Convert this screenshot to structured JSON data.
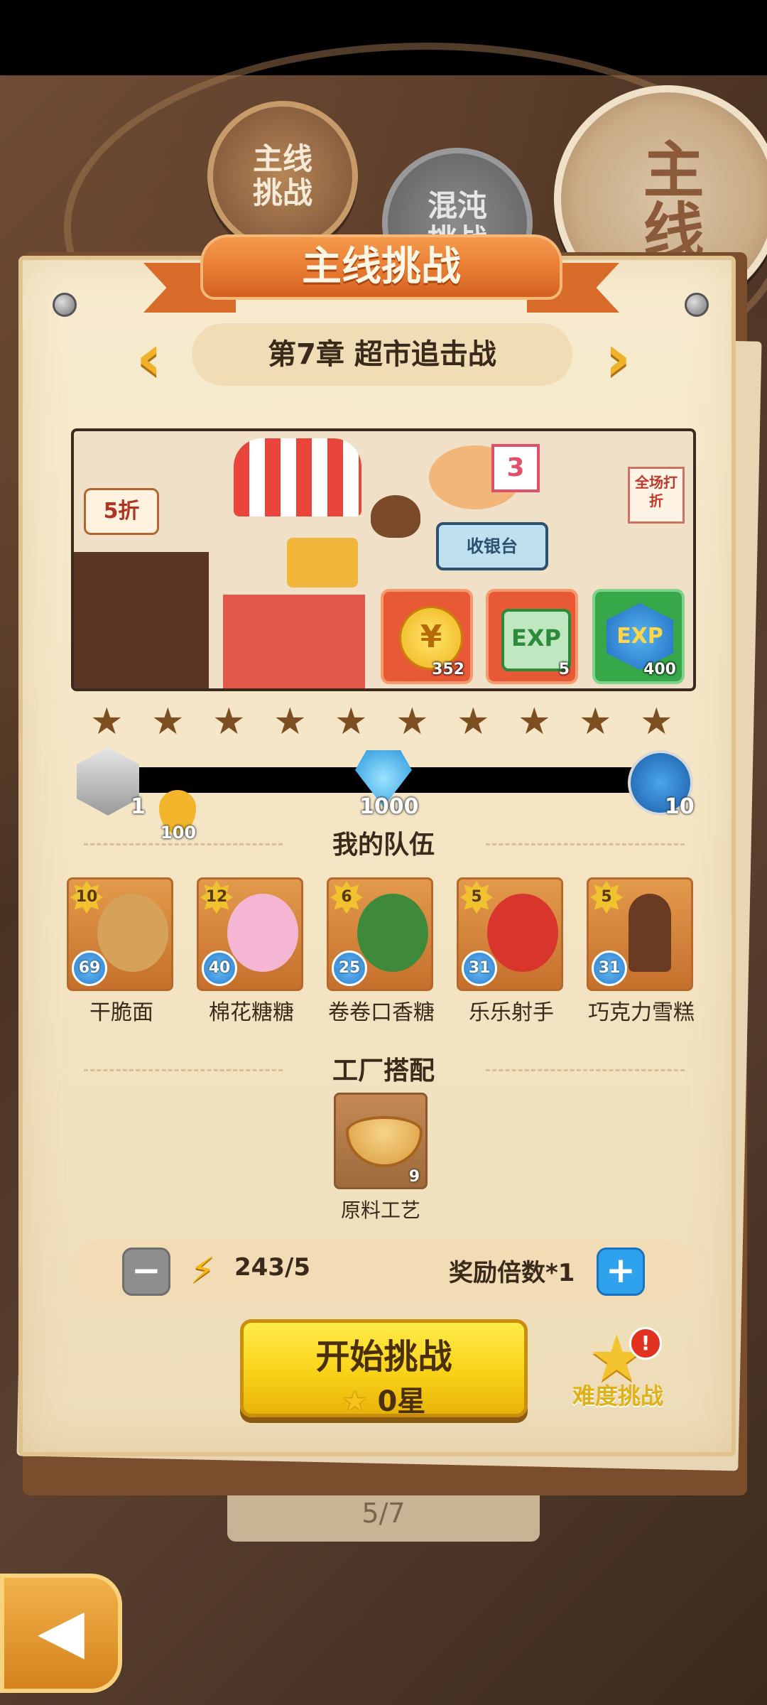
{
  "tabs": {
    "main_challenge": "主线\n挑战",
    "chaos_challenge": "混沌\n挑战",
    "big_main": "主线"
  },
  "banner_title": "主线挑战",
  "chapter": {
    "title": "第7章 超市追击战",
    "prev_icon": "chevron-left-icon",
    "next_icon": "chevron-right-icon"
  },
  "stage": {
    "sign_discount": "5折",
    "sign_checkout": "收银台",
    "sign_sale": "全场打折",
    "sign_number": "3",
    "rewards": [
      {
        "name": "coin",
        "count": "352",
        "color": "#e85a36"
      },
      {
        "name": "exp-card-green",
        "count": "5",
        "color": "#e85a36"
      },
      {
        "name": "exp-card-blue",
        "count": "400",
        "color": "#37a84a"
      }
    ]
  },
  "stars": {
    "total": 10,
    "filled": 0
  },
  "progress": {
    "milestones": [
      {
        "icon": "silver-box-icon",
        "label": "1"
      },
      {
        "icon": "drop-icon",
        "label": "100"
      },
      {
        "icon": "diamond-icon",
        "label": "1000"
      },
      {
        "icon": "medal-icon",
        "label": "10"
      }
    ],
    "fill_fraction": 0
  },
  "team": {
    "title": "我的队伍",
    "members": [
      {
        "name": "干脆面",
        "level": "10",
        "skill": "69",
        "art": "#d6a25a"
      },
      {
        "name": "棉花糖糖",
        "level": "12",
        "skill": "40",
        "art": "#f4b6d2"
      },
      {
        "name": "卷卷口香糖",
        "level": "6",
        "skill": "25",
        "art": "#3f8a3a"
      },
      {
        "name": "乐乐射手",
        "level": "5",
        "skill": "31",
        "art": "#d8352d"
      },
      {
        "name": "巧克力雪糕",
        "level": "5",
        "skill": "31",
        "art": "#6b3a22"
      }
    ]
  },
  "factory": {
    "title": "工厂搭配",
    "item_name": "原料工艺",
    "item_count": "9"
  },
  "cost": {
    "energy": "243/5",
    "multiplier": "奖励倍数*1"
  },
  "start": {
    "label": "开始挑战",
    "stars": "0星"
  },
  "difficulty_label": "难度挑战",
  "page_indicator": "5/7"
}
